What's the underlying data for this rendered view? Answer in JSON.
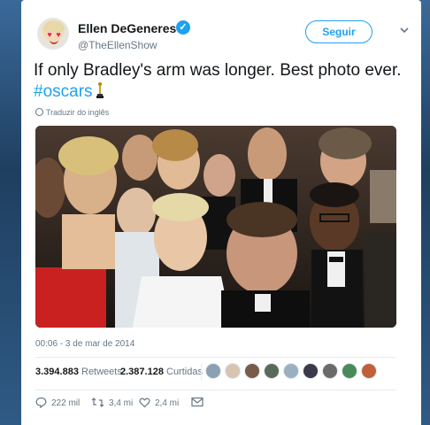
{
  "author": {
    "name": "Ellen DeGeneres",
    "handle": "@TheEllenShow",
    "verified": true
  },
  "follow_button": {
    "label": "Seguir"
  },
  "tweet": {
    "text_before": "If only Bradley's arm was longer. Best photo ever. ",
    "hashtag": "#oscars",
    "emoji_icon": "oscar-trophy-icon"
  },
  "translate_link": {
    "label": "Traduzir do inglês"
  },
  "photo": {
    "icon": "group-selfie-photo"
  },
  "timestamp": "00:06 - 3 de mar de 2014",
  "stats": {
    "retweets_count": "3.394.883",
    "retweets_label": "Retweets",
    "likes_count": "2.387.128",
    "likes_label": "Curtidas"
  },
  "actions": {
    "reply_count": "222 mil",
    "retweet_count": "3,4 mi",
    "like_count": "2,4 mi"
  },
  "colors": {
    "accent": "#1da1f2",
    "text": "#14171a",
    "muted": "#657786"
  }
}
